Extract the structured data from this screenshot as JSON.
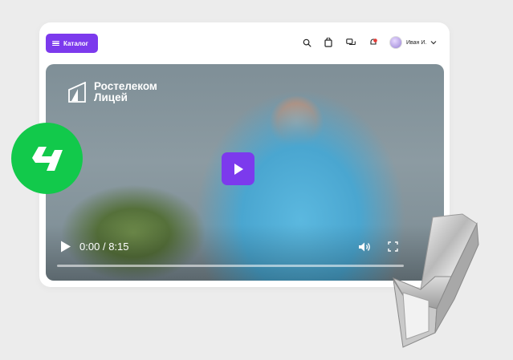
{
  "header": {
    "catalog_label": "Каталог",
    "icons": [
      "search-icon",
      "bag-icon",
      "chat-icon",
      "notification-icon"
    ],
    "user": {
      "name": "Иван И.",
      "dropdown_icon": "chevron-down-icon"
    }
  },
  "video": {
    "brand_line1": "Ростелеком",
    "brand_line2": "Лицей",
    "current_time": "0:00",
    "separator": "/",
    "duration": "8:15",
    "progress_fraction": 0,
    "controls": [
      "play-icon",
      "volume-icon",
      "fullscreen-icon"
    ]
  },
  "colors": {
    "accent": "#7c3aed",
    "badge_green": "#12c94b",
    "page_bg": "#ececec"
  }
}
